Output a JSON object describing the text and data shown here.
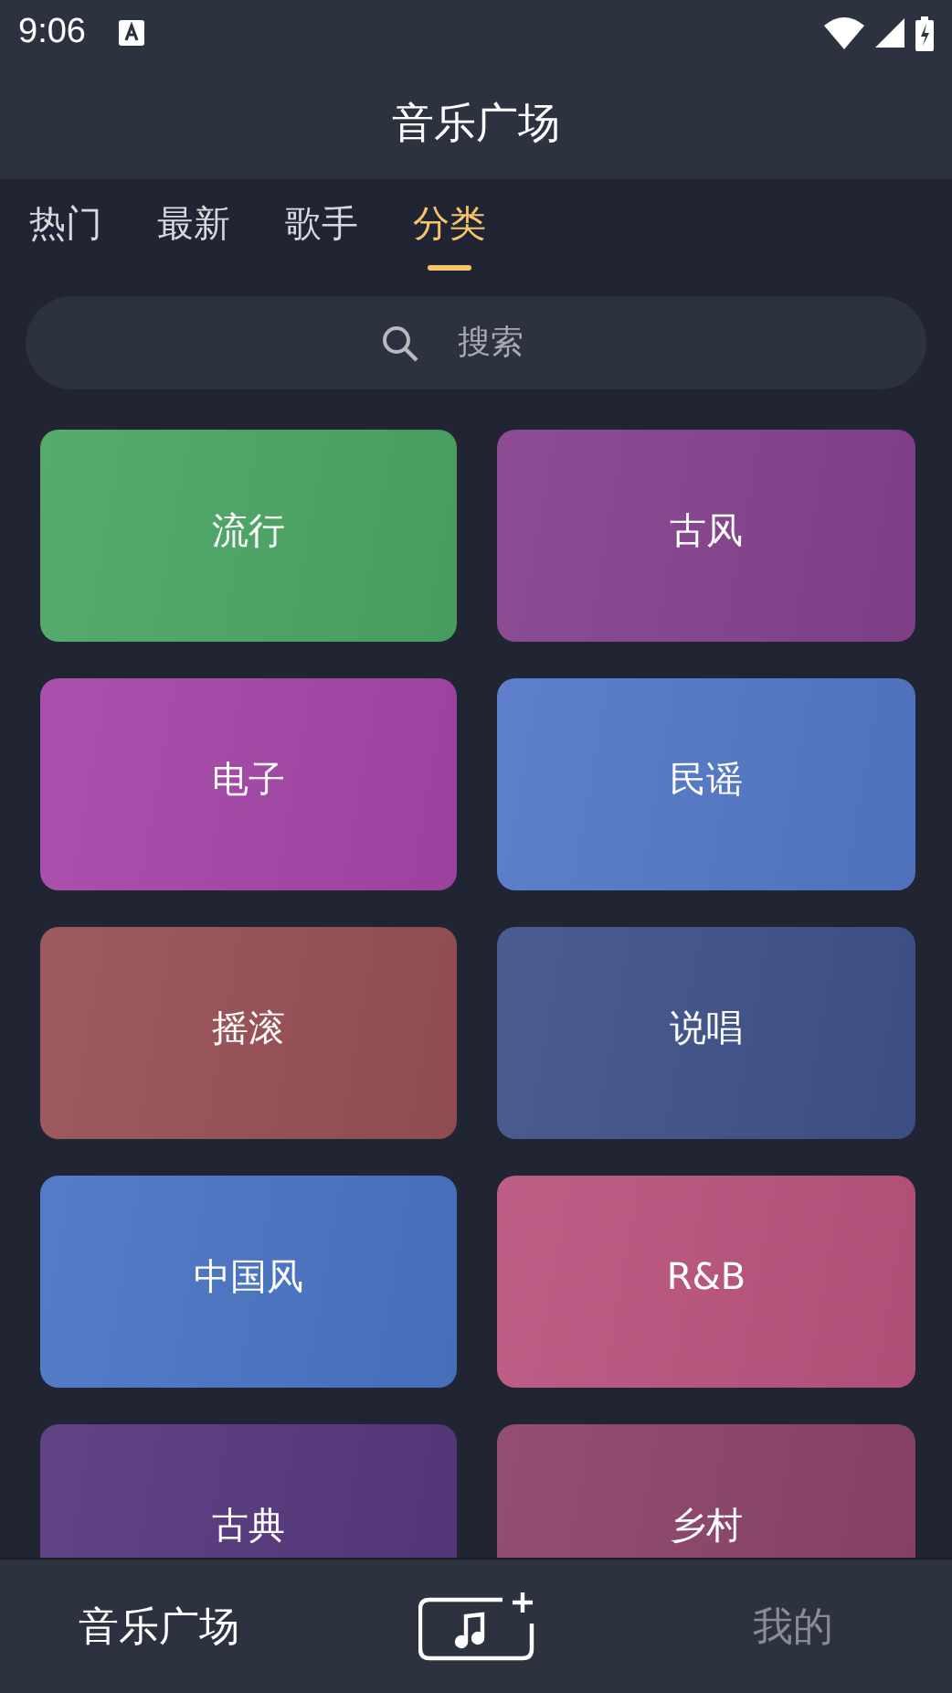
{
  "status_bar": {
    "time": "9:06"
  },
  "header": {
    "title": "音乐广场"
  },
  "tabs": [
    {
      "label": "热门",
      "selected": false
    },
    {
      "label": "最新",
      "selected": false
    },
    {
      "label": "歌手",
      "selected": false
    },
    {
      "label": "分类",
      "selected": true
    }
  ],
  "search": {
    "placeholder": "搜索"
  },
  "categories": [
    {
      "label": "流行",
      "color": "#4ba664"
    },
    {
      "label": "古风",
      "color": "#86428e"
    },
    {
      "label": "电子",
      "color": "#a446a8"
    },
    {
      "label": "民谣",
      "color": "#5478c8"
    },
    {
      "label": "摇滚",
      "color": "#985054"
    },
    {
      "label": "说唱",
      "color": "#40528a"
    },
    {
      "label": "中国风",
      "color": "#4a74c4"
    },
    {
      "label": "R&B",
      "color": "#ba547e"
    },
    {
      "label": "古典",
      "color": "#56387e"
    },
    {
      "label": "乡村",
      "color": "#8c4468"
    }
  ],
  "bottom_nav": [
    {
      "kind": "text",
      "label": "音乐广场",
      "selected": true
    },
    {
      "kind": "add",
      "selected": false
    },
    {
      "kind": "text",
      "label": "我的",
      "selected": false
    }
  ]
}
